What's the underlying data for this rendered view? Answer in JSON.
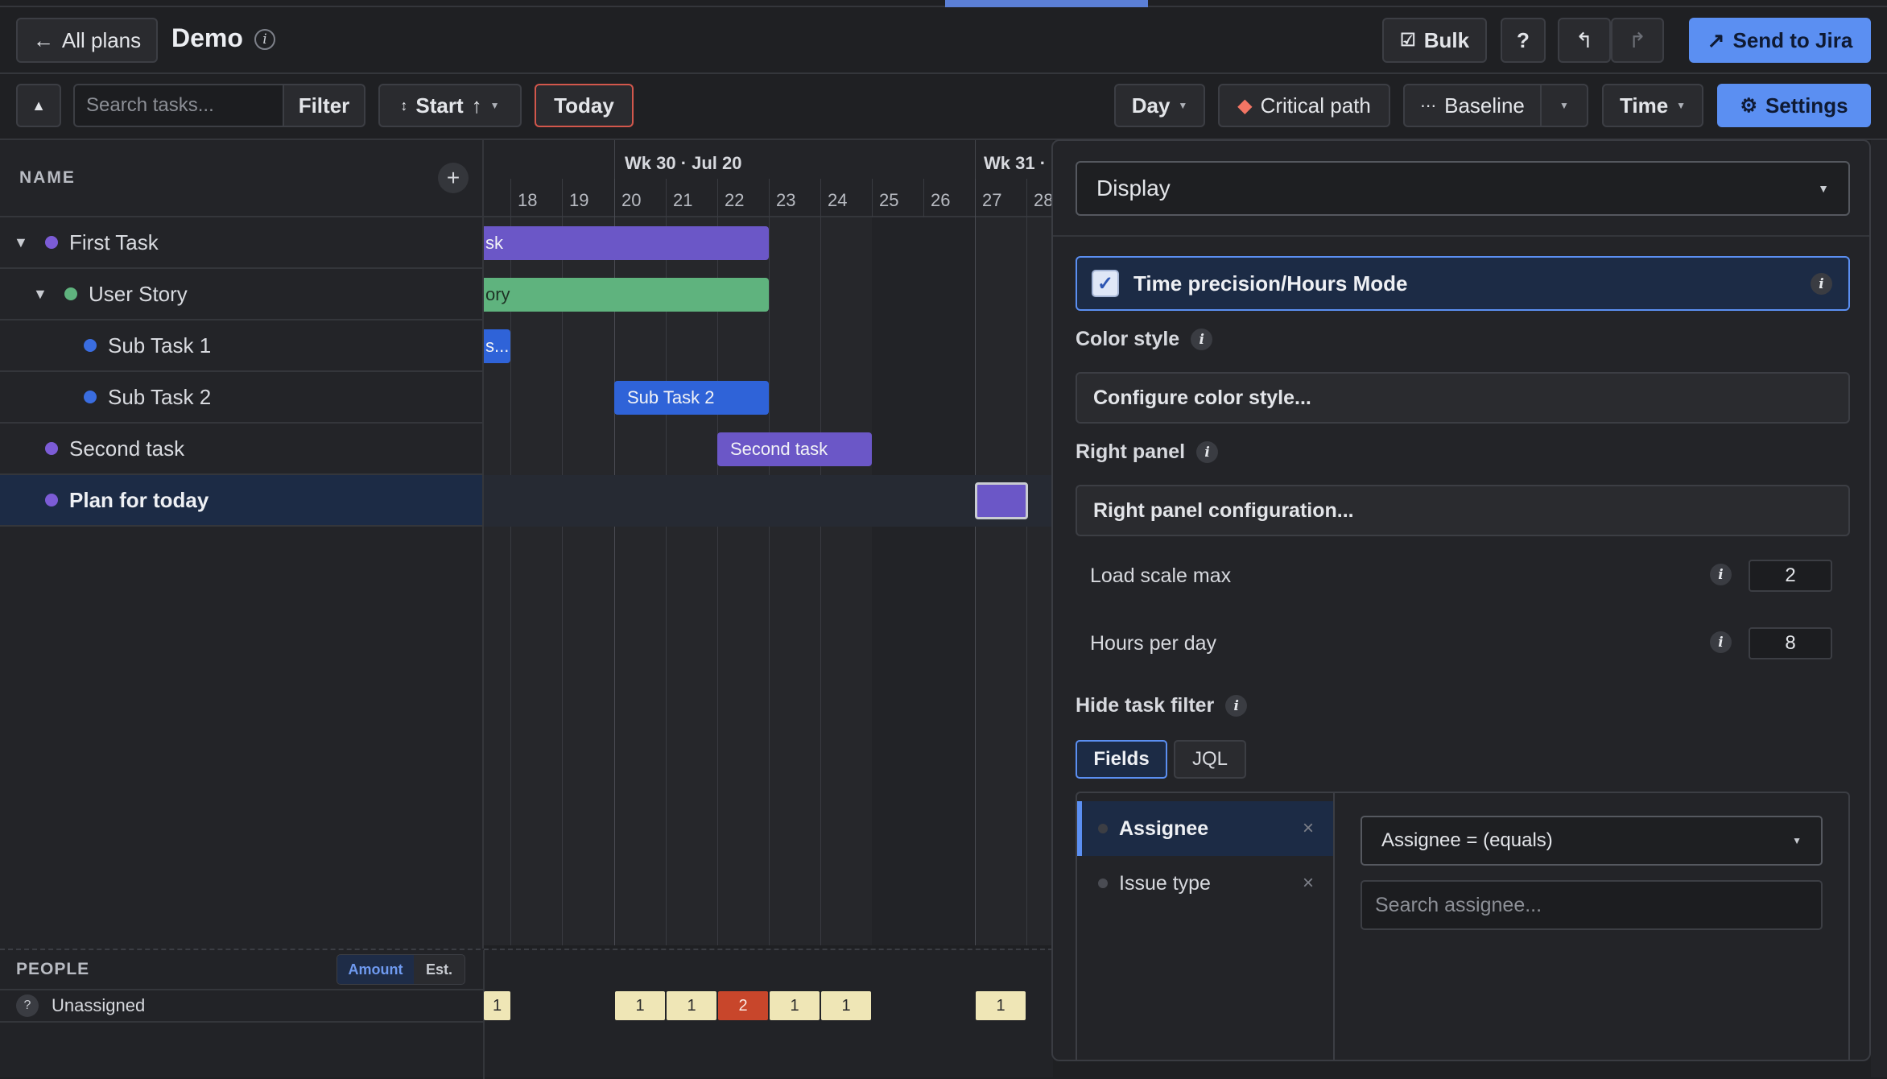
{
  "header": {
    "back_label": "All plans",
    "plan_title": "Demo",
    "bulk_label": "Bulk",
    "help_label": "?",
    "send_label": "Send to Jira"
  },
  "toolbar": {
    "search_placeholder": "Search tasks...",
    "filter_label": "Filter",
    "sort_label": "Start",
    "today_label": "Today",
    "scale_label": "Day",
    "critical_label": "Critical path",
    "baseline_label": "Baseline",
    "time_label": "Time",
    "settings_label": "Settings"
  },
  "tree": {
    "header": "NAME",
    "tasks": [
      {
        "name": "First Task",
        "color": "#7c5cd6"
      },
      {
        "name": "User Story",
        "color": "#5fb37e"
      },
      {
        "name": "Sub Task 1",
        "color": "#3a6de0"
      },
      {
        "name": "Sub Task 2",
        "color": "#3a6de0"
      },
      {
        "name": "Second task",
        "color": "#7c5cd6"
      },
      {
        "name": "Plan for today",
        "color": "#7c5cd6"
      }
    ]
  },
  "timeline": {
    "week1": "Wk 30 · Jul 20",
    "week2": "Wk 31 ·",
    "days": [
      "18",
      "19",
      "20",
      "21",
      "22",
      "23",
      "24",
      "25",
      "26",
      "27",
      "28"
    ],
    "bar_labels": {
      "first": "sk",
      "story": "ory",
      "sub1": "s...",
      "sub2": "Sub Task 2",
      "second": "Second task"
    }
  },
  "people": {
    "title": "PEOPLE",
    "toggle_amount": "Amount",
    "toggle_est": "Est.",
    "unassigned_icon": "?",
    "unassigned": "Unassigned",
    "loads": [
      "1",
      "1",
      "1",
      "2",
      "1",
      "1",
      "1"
    ]
  },
  "settings": {
    "display_label": "Display",
    "hours_mode_label": "Time precision/Hours Mode",
    "color_style_label": "Color style",
    "color_style_button": "Configure color style...",
    "right_panel_label": "Right panel",
    "right_panel_button": "Right panel configuration...",
    "load_scale_label": "Load scale max",
    "load_scale_value": "2",
    "hours_per_day_label": "Hours per day",
    "hours_per_day_value": "8",
    "hide_filter_label": "Hide task filter",
    "tab_fields": "Fields",
    "tab_jql": "JQL",
    "field_assignee": "Assignee",
    "field_issue_type": "Issue type",
    "operator_label": "Assignee = (equals)",
    "search_assignee_placeholder": "Search assignee...",
    "info_glyph": "i",
    "remove_glyph": "×"
  },
  "colors": {
    "accent": "#5b8ff2",
    "bar_purple": "#6b57c7",
    "bar_green": "#5fb37e",
    "bar_blue": "#2f63d8",
    "overload": "#c8462b",
    "load_cell": "#efe6b6"
  }
}
